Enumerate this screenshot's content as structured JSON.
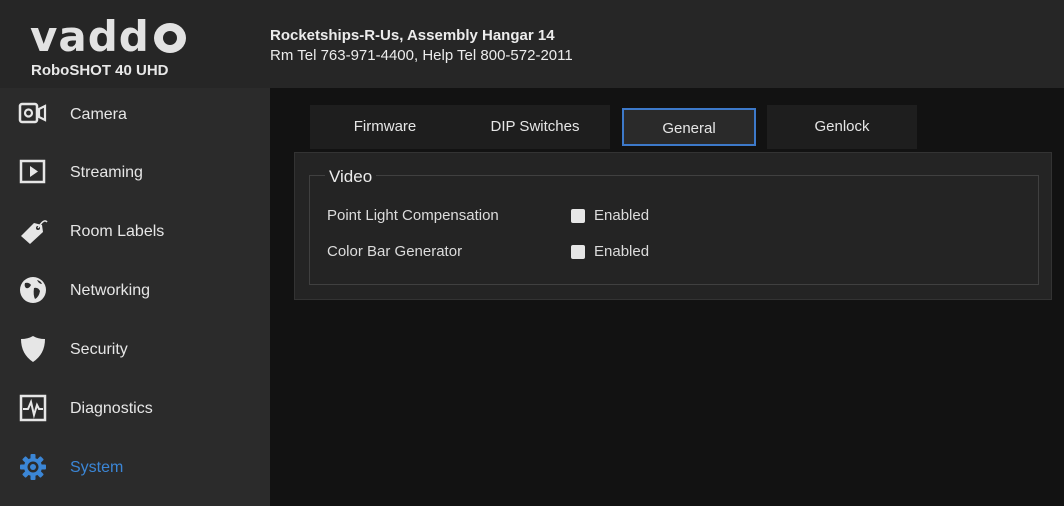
{
  "brand": {
    "logo_text": "vadd",
    "model": "RoboSHOT 40 UHD"
  },
  "header": {
    "room_name": "Rocketships-R-Us, Assembly Hangar 14",
    "room_phones": "Rm Tel 763-971-4400, Help Tel 800-572-2011"
  },
  "sidebar": {
    "items": [
      {
        "label": "Camera",
        "icon": "camera-icon"
      },
      {
        "label": "Streaming",
        "icon": "play-icon"
      },
      {
        "label": "Room Labels",
        "icon": "tag-icon"
      },
      {
        "label": "Networking",
        "icon": "globe-icon"
      },
      {
        "label": "Security",
        "icon": "shield-icon"
      },
      {
        "label": "Diagnostics",
        "icon": "pulse-icon"
      },
      {
        "label": "System",
        "icon": "gear-icon",
        "active": true
      }
    ]
  },
  "tabs": [
    {
      "label": "Firmware"
    },
    {
      "label": "DIP Switches"
    },
    {
      "label": "General",
      "active": true
    },
    {
      "label": "Genlock"
    }
  ],
  "video": {
    "legend": "Video",
    "rows": [
      {
        "label": "Point Light Compensation",
        "option": "Enabled",
        "checked": false
      },
      {
        "label": "Color Bar Generator",
        "option": "Enabled",
        "checked": false
      }
    ]
  },
  "colors": {
    "accent": "#3b86d6",
    "active_tab_border": "#3d79c9"
  }
}
